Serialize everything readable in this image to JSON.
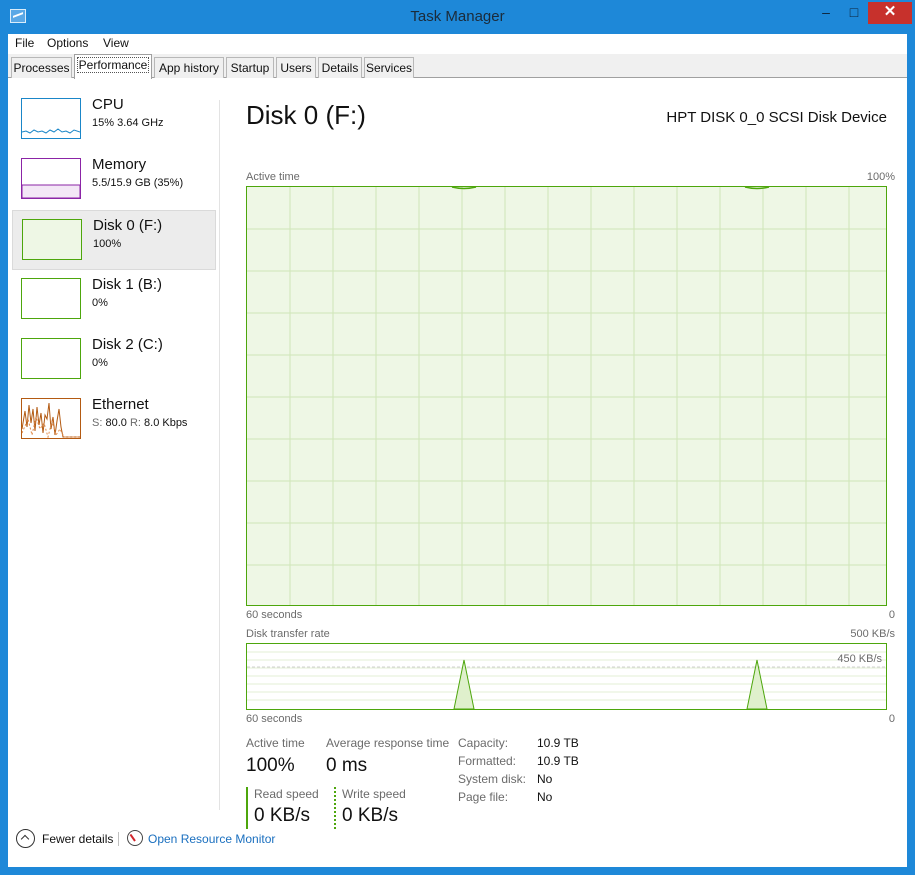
{
  "window": {
    "title": "Task Manager",
    "controls": {
      "minimize": "–",
      "maximize": "□",
      "close": "✕"
    }
  },
  "menu": [
    "File",
    "Options",
    "View"
  ],
  "tabs": [
    "Processes",
    "Performance",
    "App history",
    "Startup",
    "Users",
    "Details",
    "Services"
  ],
  "active_tab": "Performance",
  "devices": [
    {
      "name": "CPU",
      "sub_a": "15%",
      "sub_b": "3.64 GHz",
      "color": "#1a86c8"
    },
    {
      "name": "Memory",
      "sub_a": "5.5/15.9 GB (35%)",
      "sub_b": "",
      "color": "#8b24a6"
    },
    {
      "name": "Disk 0 (F:)",
      "sub_a": "100%",
      "sub_b": "",
      "color": "#4da60c"
    },
    {
      "name": "Disk 1 (B:)",
      "sub_a": "0%",
      "sub_b": "",
      "color": "#4da60c"
    },
    {
      "name": "Disk 2 (C:)",
      "sub_a": "0%",
      "sub_b": "",
      "color": "#4da60c"
    },
    {
      "name": "Ethernet",
      "sub_s_label": "S:",
      "sub_s_val": "80.0",
      "sub_r_label": "R:",
      "sub_r_val": "8.0 Kbps",
      "color": "#b35a12"
    }
  ],
  "selected_device": "Disk 0 (F:)",
  "detail": {
    "title": "Disk 0 (F:)",
    "model": "HPT DISK 0_0 SCSI Disk Device",
    "active_time_graph": {
      "label": "Active time",
      "max_label": "100%",
      "x_label": "60 seconds",
      "min_label": "0"
    },
    "transfer_graph": {
      "label": "Disk transfer rate",
      "max_label": "500 KB/s",
      "line_label": "450 KB/s",
      "x_label": "60 seconds",
      "min_label": "0"
    },
    "stats": {
      "active_time_label": "Active time",
      "active_time_value": "100%",
      "avg_response_label": "Average response time",
      "avg_response_value": "0 ms",
      "read_speed_label": "Read speed",
      "read_speed_value": "0 KB/s",
      "write_speed_label": "Write speed",
      "write_speed_value": "0 KB/s"
    },
    "properties": [
      {
        "key": "Capacity:",
        "value": "10.9 TB"
      },
      {
        "key": "Formatted:",
        "value": "10.9 TB"
      },
      {
        "key": "System disk:",
        "value": "No"
      },
      {
        "key": "Page file:",
        "value": "No"
      }
    ]
  },
  "footer": {
    "fewer_details": "Fewer details",
    "open_resource_monitor": "Open Resource Monitor"
  },
  "colors": {
    "accent": "#1e88d8",
    "disk": "#4da60c",
    "disk_fill": "#eef7e5",
    "cpu": "#1a86c8",
    "memory": "#8b24a6",
    "ethernet": "#b35a12"
  }
}
